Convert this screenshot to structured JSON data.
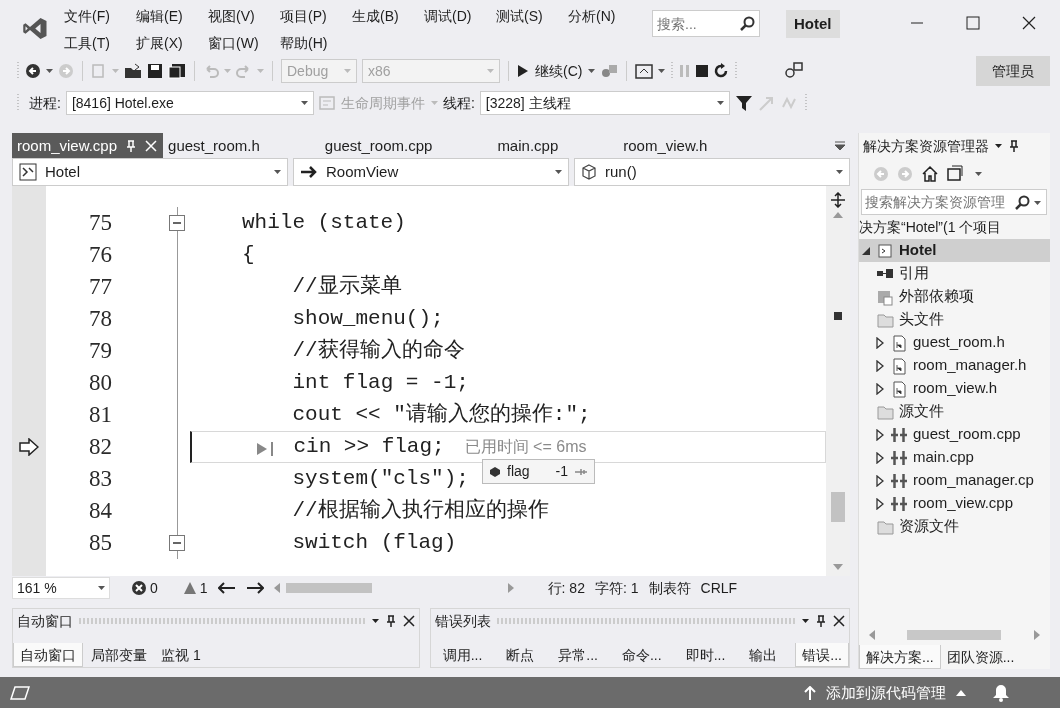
{
  "titlebar": {
    "menu": [
      "文件(F)",
      "编辑(E)",
      "视图(V)",
      "项目(P)",
      "生成(B)",
      "调试(D)",
      "测试(S)",
      "分析(N)",
      "工具(T)",
      "扩展(X)",
      "窗口(W)",
      "帮助(H)"
    ],
    "search": {
      "placeholder": "搜索..."
    },
    "solution": "Hotel"
  },
  "toolbar": {
    "config": {
      "value": "Debug",
      "disabled": true
    },
    "platform": {
      "value": "x86",
      "disabled": true
    },
    "continue": "继续(C)",
    "user": "管理员"
  },
  "debug_location": {
    "process_label": "进程:",
    "process": "[8416] Hotel.exe",
    "lifecycle": {
      "label": "生命周期事件",
      "disabled": true
    },
    "thread_label": "线程:",
    "thread": "[3228] 主线程"
  },
  "editor": {
    "tabs": [
      {
        "label": "room_view.cpp",
        "selected": true
      },
      {
        "label": "guest_room.h",
        "selected": false
      },
      {
        "label": "guest_room.cpp",
        "selected": false
      },
      {
        "label": "main.cpp",
        "selected": false
      },
      {
        "label": "room_view.h",
        "selected": false
      }
    ],
    "navigation": [
      "Hotel",
      "RoomView",
      "run()"
    ],
    "lines": [
      {
        "number": "75",
        "code": "while (state)",
        "foldable": true,
        "current": false
      },
      {
        "number": "76",
        "code": "{",
        "foldable": false,
        "current": false
      },
      {
        "number": "77",
        "code": "    //显示菜单",
        "foldable": false,
        "current": false
      },
      {
        "number": "78",
        "code": "    show_menu();",
        "foldable": false,
        "current": false
      },
      {
        "number": "79",
        "code": "    //获得输入的命令",
        "foldable": false,
        "current": false
      },
      {
        "number": "80",
        "code": "    int flag = -1;",
        "foldable": false,
        "current": false
      },
      {
        "number": "81",
        "code": "    cout << \"请输入您的操作:\";",
        "foldable": false,
        "current": false
      },
      {
        "number": "82",
        "code": "    cin >> flag;",
        "foldable": false,
        "current": true,
        "hint": "已用时间 <= 6ms"
      },
      {
        "number": "83",
        "code": "    system(\"cls\");",
        "foldable": false,
        "current": false
      },
      {
        "number": "84",
        "code": "    //根据输入执行相应的操作",
        "foldable": false,
        "current": false
      },
      {
        "number": "85",
        "code": "    switch (flag)",
        "foldable": true,
        "current": false
      }
    ],
    "datatip": {
      "name": "flag",
      "value": "-1"
    },
    "status": {
      "zoom": "161 %",
      "errors": "0",
      "warnings": "1",
      "line": "行: 82",
      "column": "字符: 1",
      "indent": "制表符",
      "line_ending": "CRLF"
    }
  },
  "panels": [
    {
      "title": "自动窗口",
      "tabs": [
        {
          "label": "自动窗口",
          "selected": true
        },
        {
          "label": "局部变量",
          "selected": false
        },
        {
          "label": "监视 1",
          "selected": false
        }
      ]
    },
    {
      "title": "错误列表",
      "tabs": [
        {
          "label": "调用...",
          "selected": false
        },
        {
          "label": "断点",
          "selected": false
        },
        {
          "label": "异常...",
          "selected": false
        },
        {
          "label": "命令...",
          "selected": false
        },
        {
          "label": "即时...",
          "selected": false
        },
        {
          "label": "输出",
          "selected": false
        },
        {
          "label": "错误...",
          "selected": true
        }
      ]
    }
  ],
  "solution_explorer": {
    "title": "解决方案资源管理器",
    "search": {
      "placeholder": "搜索解决方案资源管理"
    },
    "solution": "决方案“Hotel”(1 个项目",
    "tree": [
      {
        "label": "Hotel",
        "kind": "project",
        "selected": true,
        "expanded": true,
        "children": [
          {
            "label": "引用",
            "kind": "references",
            "selected": false
          },
          {
            "label": "外部依赖项",
            "kind": "external",
            "selected": false
          },
          {
            "label": "头文件",
            "kind": "folder",
            "selected": false,
            "children": [
              {
                "label": "guest_room.h",
                "kind": "header",
                "selected": false,
                "expanded": false
              },
              {
                "label": "room_manager.h",
                "kind": "header",
                "selected": false,
                "expanded": false
              },
              {
                "label": "room_view.h",
                "kind": "header",
                "selected": false,
                "expanded": false
              }
            ]
          },
          {
            "label": "源文件",
            "kind": "folder",
            "selected": false,
            "children": [
              {
                "label": "guest_room.cpp",
                "kind": "source",
                "selected": false,
                "expanded": false
              },
              {
                "label": "main.cpp",
                "kind": "source",
                "selected": false,
                "expanded": false
              },
              {
                "label": "room_manager.cp",
                "kind": "source",
                "selected": false,
                "expanded": false
              },
              {
                "label": "room_view.cpp",
                "kind": "source",
                "selected": false,
                "expanded": false
              }
            ]
          },
          {
            "label": "资源文件",
            "kind": "folder",
            "selected": false
          }
        ]
      }
    ],
    "tabs": [
      {
        "label": "解决方案...",
        "selected": true
      },
      {
        "label": "团队资源...",
        "selected": false
      }
    ]
  },
  "status_bar": {
    "source_control": "添加到源代码管理"
  }
}
